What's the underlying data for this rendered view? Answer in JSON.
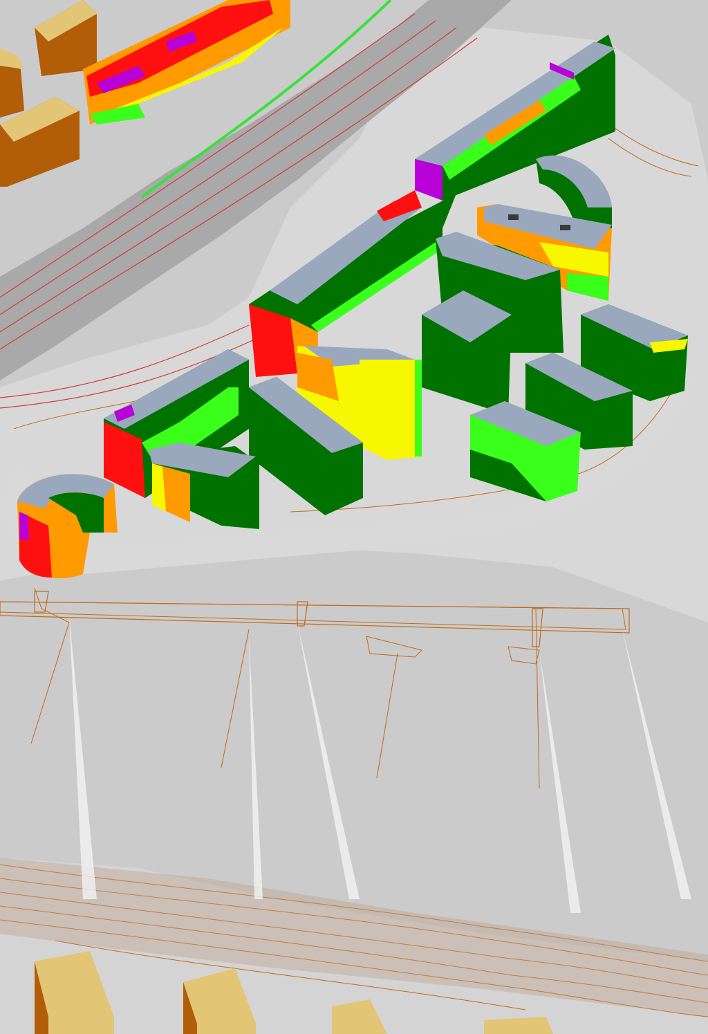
{
  "view": {
    "kind": "3d-noise-map",
    "description_visible_text": ""
  },
  "legend": {
    "colors": {
      "roof": "#9aa8bd",
      "very_high": "#b800d8",
      "high": "#ff1010",
      "medium_high": "#ff9b00",
      "medium": "#f7f700",
      "low": "#39ff1a",
      "very_low": "#007200",
      "existing_building_top": "#e3c576",
      "existing_building_side": "#b25d08",
      "terrain": "#cbcbcb",
      "road": "#a9a9a9",
      "contour": "#c26a1a",
      "road_line": "#d23a3a",
      "road_edge": "#37e23b"
    }
  },
  "scene": {
    "new_buildings_count": 14,
    "existing_buildings_count": 7
  }
}
